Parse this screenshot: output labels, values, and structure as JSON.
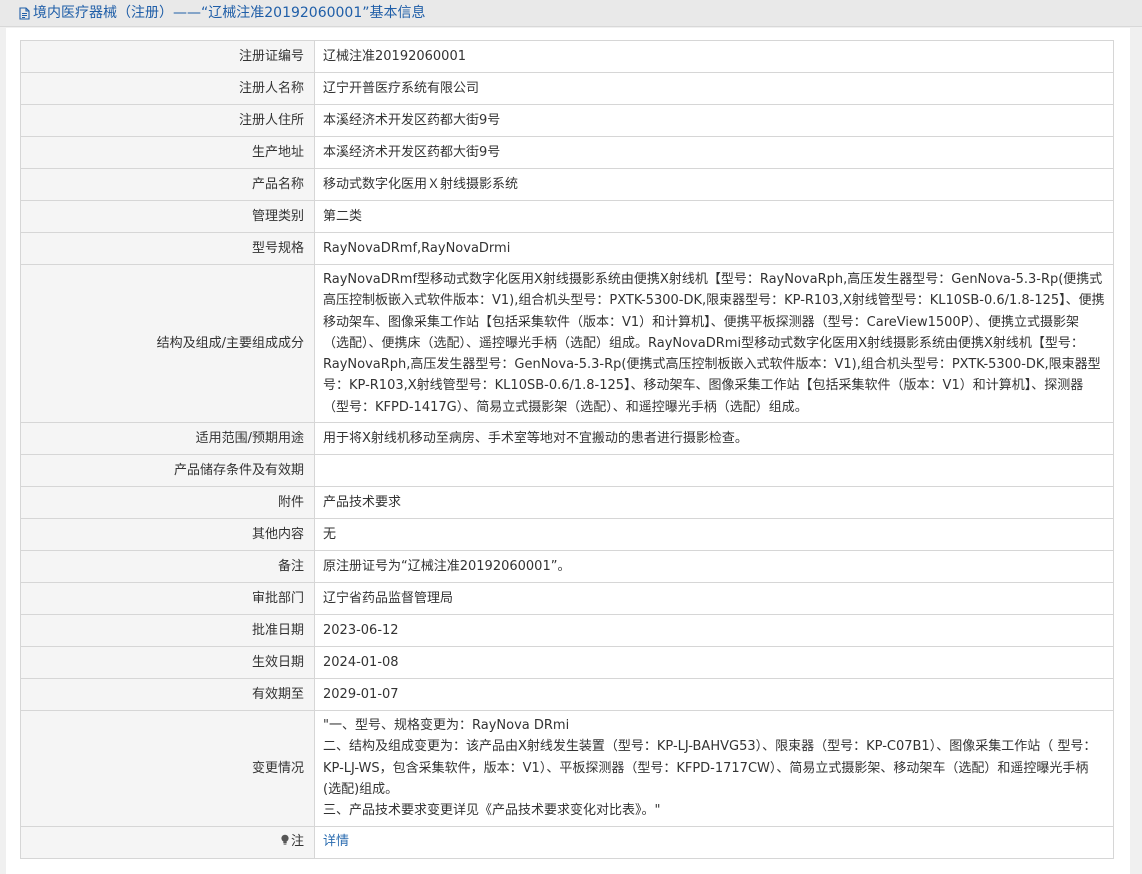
{
  "header": {
    "title": "境内医疗器械（注册）——“辽械注准20192060001”基本信息"
  },
  "rows": [
    {
      "label": "注册证编号",
      "value": "辽械注准20192060001"
    },
    {
      "label": "注册人名称",
      "value": "辽宁开普医疗系统有限公司"
    },
    {
      "label": "注册人住所",
      "value": "本溪经济术开发区药都大街9号"
    },
    {
      "label": "生产地址",
      "value": "本溪经济术开发区药都大街9号"
    },
    {
      "label": "产品名称",
      "value": "移动式数字化医用Ｘ射线摄影系统"
    },
    {
      "label": "管理类别",
      "value": "第二类"
    },
    {
      "label": "型号规格",
      "value": "RayNovaDRmf,RayNovaDrmi"
    },
    {
      "label": "结构及组成/主要组成成分",
      "value": "RayNovaDRmf型移动式数字化医用X射线摄影系统由便携X射线机【型号：RayNovaRph,高压发生器型号：GenNova-5.3-Rp(便携式高压控制板嵌入式软件版本：V1),组合机头型号：PXTK-5300-DK,限束器型号：KP-R103,X射线管型号：KL10SB-0.6/1.8-125】、便携移动架车、图像采集工作站【包括采集软件（版本：V1）和计算机】、便携平板探测器（型号：CareView1500P）、便携立式摄影架（选配）、便携床（选配）、遥控曝光手柄（选配）组成。RayNovaDRmi型移动式数字化医用X射线摄影系统由便携X射线机【型号：RayNovaRph,高压发生器型号：GenNova-5.3-Rp(便携式高压控制板嵌入式软件版本：V1),组合机头型号：PXTK-5300-DK,限束器型号：KP-R103,X射线管型号：KL10SB-0.6/1.8-125】、移动架车、图像采集工作站【包括采集软件（版本：V1）和计算机】、探测器（型号：KFPD-1417G）、简易立式摄影架（选配）、和遥控曝光手柄（选配）组成。"
    },
    {
      "label": "适用范围/预期用途",
      "value": "用于将X射线机移动至病房、手术室等地对不宜搬动的患者进行摄影检查。"
    },
    {
      "label": "产品储存条件及有效期",
      "value": ""
    },
    {
      "label": "附件",
      "value": "产品技术要求"
    },
    {
      "label": "其他内容",
      "value": "无"
    },
    {
      "label": "备注",
      "value": "原注册证号为“辽械注准20192060001”。"
    },
    {
      "label": "审批部门",
      "value": "辽宁省药品监督管理局"
    },
    {
      "label": "批准日期",
      "value": "2023-06-12"
    },
    {
      "label": "生效日期",
      "value": "2024-01-08"
    },
    {
      "label": "有效期至",
      "value": "2029-01-07"
    },
    {
      "label": "变更情况",
      "value": "\"一、型号、规格变更为：RayNova DRmi\n二、结构及组成变更为：该产品由X射线发生装置（型号：KP-LJ-BAHVG53）、限束器（型号：KP-C07B1）、图像采集工作站（ 型号：KP-LJ-WS，包含采集软件，版本：V1）、平板探测器（型号：KFPD-1717CW）、简易立式摄影架、移动架车（选配）和遥控曝光手柄 (选配)组成。\n三、产品技术要求变更详见《产品技术要求变化对比表》。\""
    }
  ],
  "note": {
    "label": "注",
    "link": "详情"
  }
}
